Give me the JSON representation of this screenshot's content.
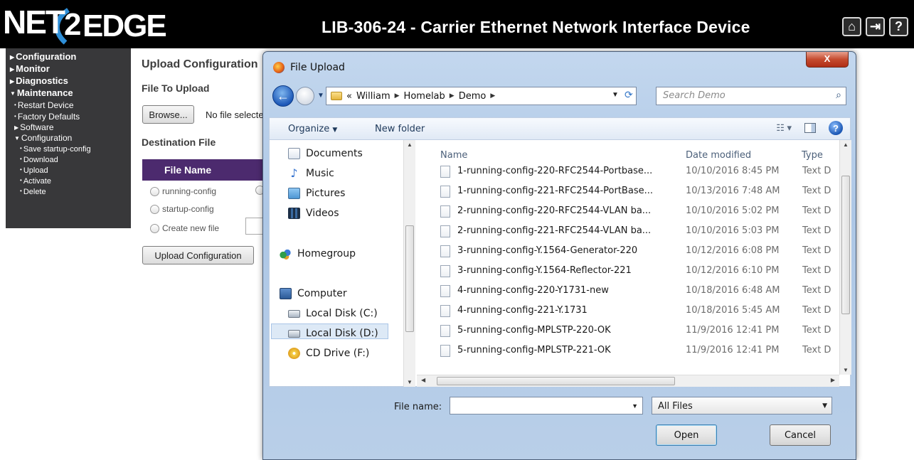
{
  "header": {
    "logo_left": "NET",
    "logo_mid": "2",
    "logo_right": "EDGE",
    "title": "LIB-306-24 - Carrier Ethernet Network Interface Device",
    "icons": [
      "home-icon",
      "logout-icon",
      "help-icon"
    ]
  },
  "nav": {
    "top": [
      {
        "label": "Configuration",
        "expanded": false
      },
      {
        "label": "Monitor",
        "expanded": false
      },
      {
        "label": "Diagnostics",
        "expanded": false
      },
      {
        "label": "Maintenance",
        "expanded": true
      }
    ],
    "maintenance": {
      "restart": "Restart Device",
      "factory": "Factory Defaults",
      "software": "Software",
      "configuration": "Configuration",
      "config_items": [
        "Save startup-config",
        "Download",
        "Upload",
        "Activate",
        "Delete"
      ]
    }
  },
  "main": {
    "heading": "Upload Configuration",
    "file_to_upload": "File To Upload",
    "browse_label": "Browse...",
    "no_file": "No file selected.",
    "destination_file": "Destination File",
    "table_header": "File Name",
    "radios": [
      {
        "label": "running-config",
        "selected": false
      },
      {
        "label": "startup-config",
        "selected": false
      },
      {
        "label": "Create new file",
        "selected": false
      }
    ],
    "upload_button": "Upload Configuration"
  },
  "dialog": {
    "title": "File Upload",
    "close": "X",
    "breadcrumb": [
      "«",
      "William",
      "Homelab",
      "Demo"
    ],
    "search_placeholder": "Search Demo",
    "toolbar": {
      "organize": "Organize",
      "new_folder": "New folder"
    },
    "nav_pane": [
      {
        "label": "Documents",
        "icon": "documents-icon"
      },
      {
        "label": "Music",
        "icon": "music-icon"
      },
      {
        "label": "Pictures",
        "icon": "pictures-icon"
      },
      {
        "label": "Videos",
        "icon": "videos-icon"
      },
      {
        "label": "Homegroup",
        "icon": "homegroup-icon"
      },
      {
        "label": "Computer",
        "icon": "computer-icon"
      },
      {
        "label": "Local Disk (C:)",
        "icon": "disk-icon"
      },
      {
        "label": "Local Disk (D:)",
        "icon": "disk-icon",
        "selected": true
      },
      {
        "label": "CD Drive (F:)",
        "icon": "cd-drive-icon"
      }
    ],
    "columns": [
      "Name",
      "Date modified",
      "Type"
    ],
    "files": [
      {
        "name": "1-running-config-220-RFC2544-Portbase...",
        "date": "10/10/2016 8:45 PM",
        "type": "Text D"
      },
      {
        "name": "1-running-config-221-RFC2544-PortBase...",
        "date": "10/13/2016 7:48 AM",
        "type": "Text D"
      },
      {
        "name": "2-running-config-220-RFC2544-VLAN ba...",
        "date": "10/10/2016 5:02 PM",
        "type": "Text D"
      },
      {
        "name": "2-running-config-221-RFC2544-VLAN ba...",
        "date": "10/10/2016 5:03 PM",
        "type": "Text D"
      },
      {
        "name": "3-running-config-Y.1564-Generator-220",
        "date": "10/12/2016 6:08 PM",
        "type": "Text D"
      },
      {
        "name": "3-running-config-Y.1564-Reflector-221",
        "date": "10/12/2016 6:10 PM",
        "type": "Text D"
      },
      {
        "name": "4-running-config-220-Y1731-new",
        "date": "10/18/2016 6:48 AM",
        "type": "Text D"
      },
      {
        "name": "4-running-config-221-Y.1731",
        "date": "10/18/2016 5:45 AM",
        "type": "Text D"
      },
      {
        "name": "5-running-config-MPLSTP-220-OK",
        "date": "11/9/2016 12:41 PM",
        "type": "Text D"
      },
      {
        "name": "5-running-config-MPLSTP-221-OK",
        "date": "11/9/2016 12:41 PM",
        "type": "Text D"
      }
    ],
    "file_name_label": "File name:",
    "file_name_value": "",
    "filter": "All Files",
    "open_button": "Open",
    "cancel_button": "Cancel"
  }
}
